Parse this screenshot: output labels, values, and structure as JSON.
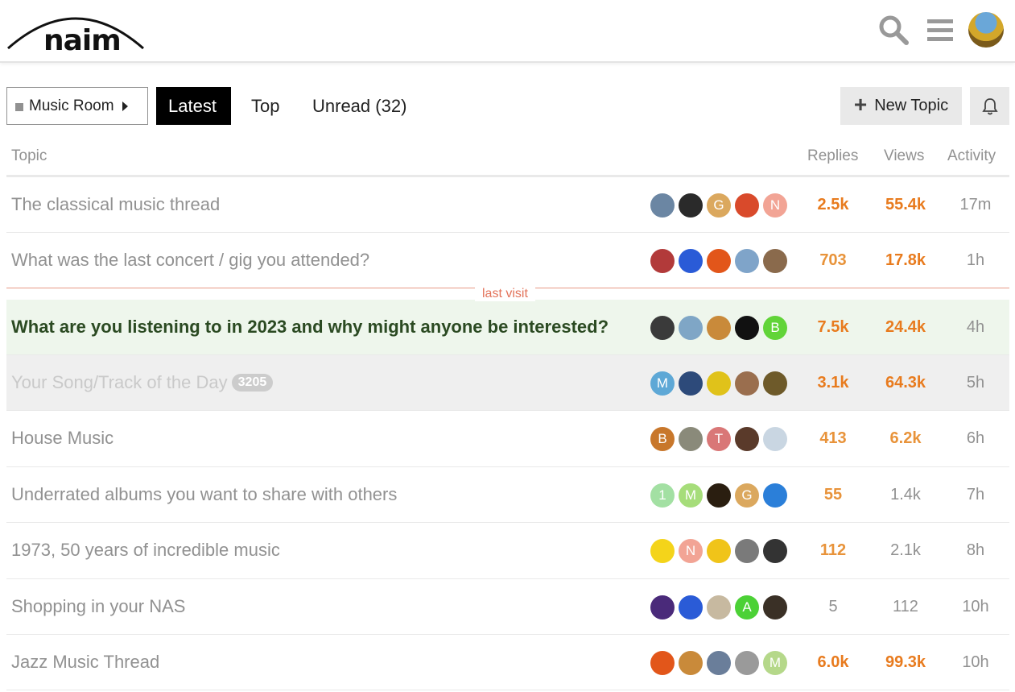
{
  "header": {
    "logo_text": "naim"
  },
  "nav": {
    "category": "Music Room",
    "tabs": [
      {
        "label": "Latest",
        "active": true
      },
      {
        "label": "Top",
        "active": false
      },
      {
        "label": "Unread (32)",
        "active": false
      }
    ],
    "new_topic": "New Topic"
  },
  "table": {
    "headers": {
      "topic": "Topic",
      "replies": "Replies",
      "views": "Views",
      "activity": "Activity"
    },
    "last_visit": "last visit",
    "rows": [
      {
        "title": "The classical music thread",
        "badge": "",
        "replies": "2.5k",
        "views": "55.4k",
        "activity": "17m",
        "state": "normal",
        "posters": [
          {
            "letter": "",
            "color": "#6b86a3"
          },
          {
            "letter": "",
            "color": "#2a2a2a"
          },
          {
            "letter": "G",
            "color": "#dba85e"
          },
          {
            "letter": "",
            "color": "#d94a2b"
          },
          {
            "letter": "N",
            "color": "#f2a495"
          }
        ]
      },
      {
        "title": "What was the last concert / gig you attended?",
        "badge": "",
        "replies": "703",
        "views": "17.8k",
        "activity": "1h",
        "state": "normal",
        "posters": [
          {
            "letter": "",
            "color": "#b23a3a"
          },
          {
            "letter": "",
            "color": "#2a5bd7"
          },
          {
            "letter": "",
            "color": "#e2561a"
          },
          {
            "letter": "",
            "color": "#7fa4c9"
          },
          {
            "letter": "",
            "color": "#8a6a4c"
          }
        ]
      },
      {
        "title": "What are you listening to in 2023 and why might anyone be interested?",
        "badge": "",
        "replies": "7.5k",
        "views": "24.4k",
        "activity": "4h",
        "state": "highlight",
        "posters": [
          {
            "letter": "",
            "color": "#3a3a3a"
          },
          {
            "letter": "",
            "color": "#7fa6c6"
          },
          {
            "letter": "",
            "color": "#c98a3a"
          },
          {
            "letter": "",
            "color": "#111111"
          },
          {
            "letter": "B",
            "color": "#61d438"
          }
        ]
      },
      {
        "title": "Your Song/Track of the Day",
        "badge": "3205",
        "replies": "3.1k",
        "views": "64.3k",
        "activity": "5h",
        "state": "muted",
        "posters": [
          {
            "letter": "M",
            "color": "#5ea8d6"
          },
          {
            "letter": "",
            "color": "#2d4a7a"
          },
          {
            "letter": "",
            "color": "#e0c21a"
          },
          {
            "letter": "",
            "color": "#9a6e4e"
          },
          {
            "letter": "",
            "color": "#6e5a2a"
          }
        ]
      },
      {
        "title": "House Music",
        "badge": "",
        "replies": "413",
        "views": "6.2k",
        "activity": "6h",
        "state": "normal",
        "posters": [
          {
            "letter": "B",
            "color": "#c8772b"
          },
          {
            "letter": "",
            "color": "#8a8a7a"
          },
          {
            "letter": "T",
            "color": "#d97777"
          },
          {
            "letter": "",
            "color": "#5a3a2a"
          },
          {
            "letter": "",
            "color": "#c9d6e2"
          }
        ]
      },
      {
        "title": "Underrated albums you want to share with others",
        "badge": "",
        "replies": "55",
        "views": "1.4k",
        "activity": "7h",
        "state": "normal",
        "posters": [
          {
            "letter": "1",
            "color": "#a3e0a3"
          },
          {
            "letter": "M",
            "color": "#a6dd7a"
          },
          {
            "letter": "",
            "color": "#2a1e10"
          },
          {
            "letter": "G",
            "color": "#dba85e"
          },
          {
            "letter": "",
            "color": "#2b7fd9"
          }
        ]
      },
      {
        "title": "1973, 50 years of incredible music",
        "badge": "",
        "replies": "112",
        "views": "2.1k",
        "activity": "8h",
        "state": "normal",
        "posters": [
          {
            "letter": "",
            "color": "#f4d41a"
          },
          {
            "letter": "N",
            "color": "#f2a495"
          },
          {
            "letter": "",
            "color": "#f0c419"
          },
          {
            "letter": "",
            "color": "#7a7a7a"
          },
          {
            "letter": "",
            "color": "#333333"
          }
        ]
      },
      {
        "title": "Shopping in your NAS",
        "badge": "",
        "replies": "5",
        "views": "112",
        "activity": "10h",
        "state": "normal",
        "posters": [
          {
            "letter": "",
            "color": "#4a2a7a"
          },
          {
            "letter": "",
            "color": "#2a5bd7"
          },
          {
            "letter": "",
            "color": "#c7b9a0"
          },
          {
            "letter": "A",
            "color": "#4cd136"
          },
          {
            "letter": "",
            "color": "#3a3026"
          }
        ]
      },
      {
        "title": "Jazz Music Thread",
        "badge": "",
        "replies": "6.0k",
        "views": "99.3k",
        "activity": "10h",
        "state": "normal",
        "posters": [
          {
            "letter": "",
            "color": "#e2561a"
          },
          {
            "letter": "",
            "color": "#c98a3a"
          },
          {
            "letter": "",
            "color": "#6a7e9a"
          },
          {
            "letter": "",
            "color": "#9a9a9a"
          },
          {
            "letter": "M",
            "color": "#b5d88a"
          }
        ]
      }
    ]
  }
}
